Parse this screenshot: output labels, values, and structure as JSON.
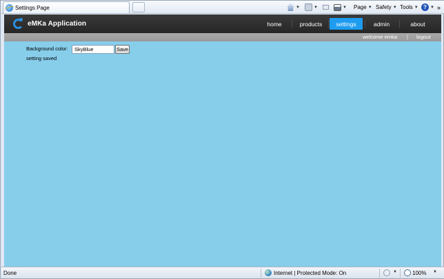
{
  "browser": {
    "tab_title": "Settings Page",
    "toolbar": {
      "home_icon": "home-icon",
      "feeds_icon": "feeds-icon",
      "mail_icon": "read-mail-icon",
      "print_icon": "print-icon",
      "page_menu": "Page",
      "safety_menu": "Safety",
      "tools_menu": "Tools",
      "help_icon": "?",
      "more_icon": "»"
    }
  },
  "app": {
    "title": "eMKa Application",
    "nav": [
      {
        "label": "home",
        "active": false
      },
      {
        "label": "products",
        "active": false
      },
      {
        "label": "settings",
        "active": true
      },
      {
        "label": "admin",
        "active": false
      },
      {
        "label": "about",
        "active": false
      }
    ],
    "welcome_text": "welcome emka",
    "separator": "|",
    "logout_label": "logout"
  },
  "settings_form": {
    "background_label": "Background color:",
    "background_value": "SkyBlue",
    "save_label": "Save",
    "status_message": "setting saved"
  },
  "status_bar": {
    "status": "Done",
    "zone": "Internet | Protected Mode: On",
    "zoom": "100%"
  },
  "colors": {
    "content_background": "#87ceeb",
    "header_background": "#2f2f2f",
    "nav_active": "#1e9cf0",
    "sub_header": "#a3a3a3"
  }
}
